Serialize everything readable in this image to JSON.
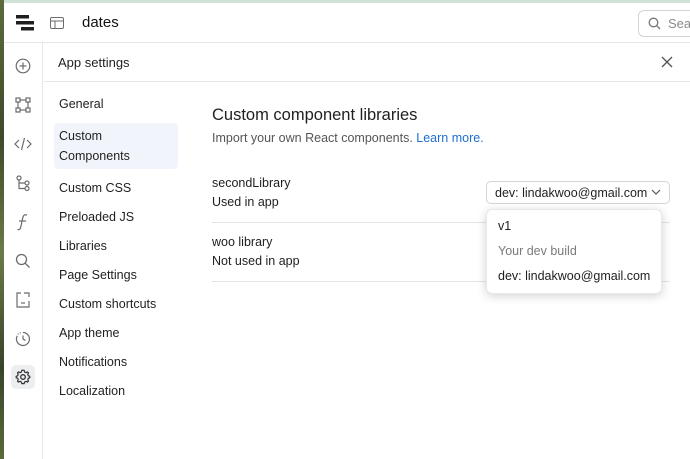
{
  "topbar": {
    "app_name": "dates",
    "search_placeholder": "Search"
  },
  "left_rail": {
    "icons": [
      "add-icon",
      "components-icon",
      "code-icon",
      "tree-icon",
      "function-icon",
      "search-icon",
      "export-icon",
      "history-icon",
      "gear-icon"
    ]
  },
  "settings": {
    "title": "App settings",
    "nav": [
      {
        "label": "General"
      },
      {
        "label": "Custom Components",
        "label_line1": "Custom",
        "label_line2": "Components",
        "active": true
      },
      {
        "label": "Custom CSS"
      },
      {
        "label": "Preloaded JS"
      },
      {
        "label": "Libraries"
      },
      {
        "label": "Page Settings"
      },
      {
        "label": "Custom shortcuts"
      },
      {
        "label": "App theme"
      },
      {
        "label": "Notifications"
      },
      {
        "label": "Localization"
      }
    ]
  },
  "content": {
    "title": "Custom component libraries",
    "subtitle": "Import your own React components.",
    "learn_more": "Learn more.",
    "libraries": [
      {
        "name": "secondLibrary",
        "status": "Used in app",
        "selected_version": "dev: lindakwoo@gmail.com"
      },
      {
        "name": "woo library",
        "status": "Not used in app"
      }
    ]
  },
  "dropdown": {
    "options": [
      {
        "label": "v1",
        "kind": "option"
      },
      {
        "label": "Your dev build",
        "kind": "header"
      },
      {
        "label": "dev: lindakwoo@gmail.com",
        "kind": "option"
      }
    ]
  },
  "colors": {
    "accent": "#1f6fd1",
    "active_nav_bg": "#f1f5fb",
    "border": "#e6e6e6"
  }
}
